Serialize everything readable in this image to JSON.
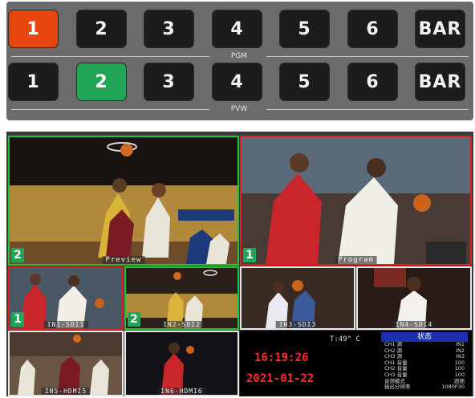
{
  "panel": {
    "pgm_label": "PGM",
    "pvw_label": "PVW",
    "pgm_buttons": [
      "1",
      "2",
      "3",
      "4",
      "5",
      "6",
      "BAR"
    ],
    "pvw_buttons": [
      "1",
      "2",
      "3",
      "4",
      "5",
      "6",
      "BAR"
    ],
    "pgm_active_index": 0,
    "pvw_active_index": 1,
    "colors": {
      "pgm_active": "#e8460f",
      "pvw_active": "#22a556",
      "button": "#1c1c1c",
      "panel": "#6b6b6b"
    }
  },
  "multiview": {
    "preview": {
      "number": "2",
      "caption": "Preview"
    },
    "program": {
      "number": "1",
      "caption": "Program"
    },
    "inputs": [
      {
        "number": "1",
        "caption": "IN1-SDI1"
      },
      {
        "number": "2",
        "caption": "IN2-SDI2"
      },
      {
        "number": "",
        "caption": "IN3-SDI3"
      },
      {
        "number": "",
        "caption": "IN4-SDI4"
      },
      {
        "number": "",
        "caption": "IN5-HDMI5"
      },
      {
        "number": "",
        "caption": "IN6-HDMI6"
      }
    ],
    "info": {
      "temperature": "T:49° C",
      "time": "16:19:26",
      "date": "2021-01-22",
      "status_title": "状态",
      "status_rows": [
        {
          "label": "CH1 源",
          "value": "IN1"
        },
        {
          "label": "CH2 源",
          "value": "IN2"
        },
        {
          "label": "CH3 源",
          "value": "IN3"
        },
        {
          "label": "CH1 音量",
          "value": "100"
        },
        {
          "label": "CH2 音量",
          "value": "100"
        },
        {
          "label": "CH3 音量",
          "value": "100"
        },
        {
          "label": "音频模式",
          "value": "跟随"
        },
        {
          "label": "输出分辨率",
          "value": "1080P30"
        }
      ]
    }
  }
}
